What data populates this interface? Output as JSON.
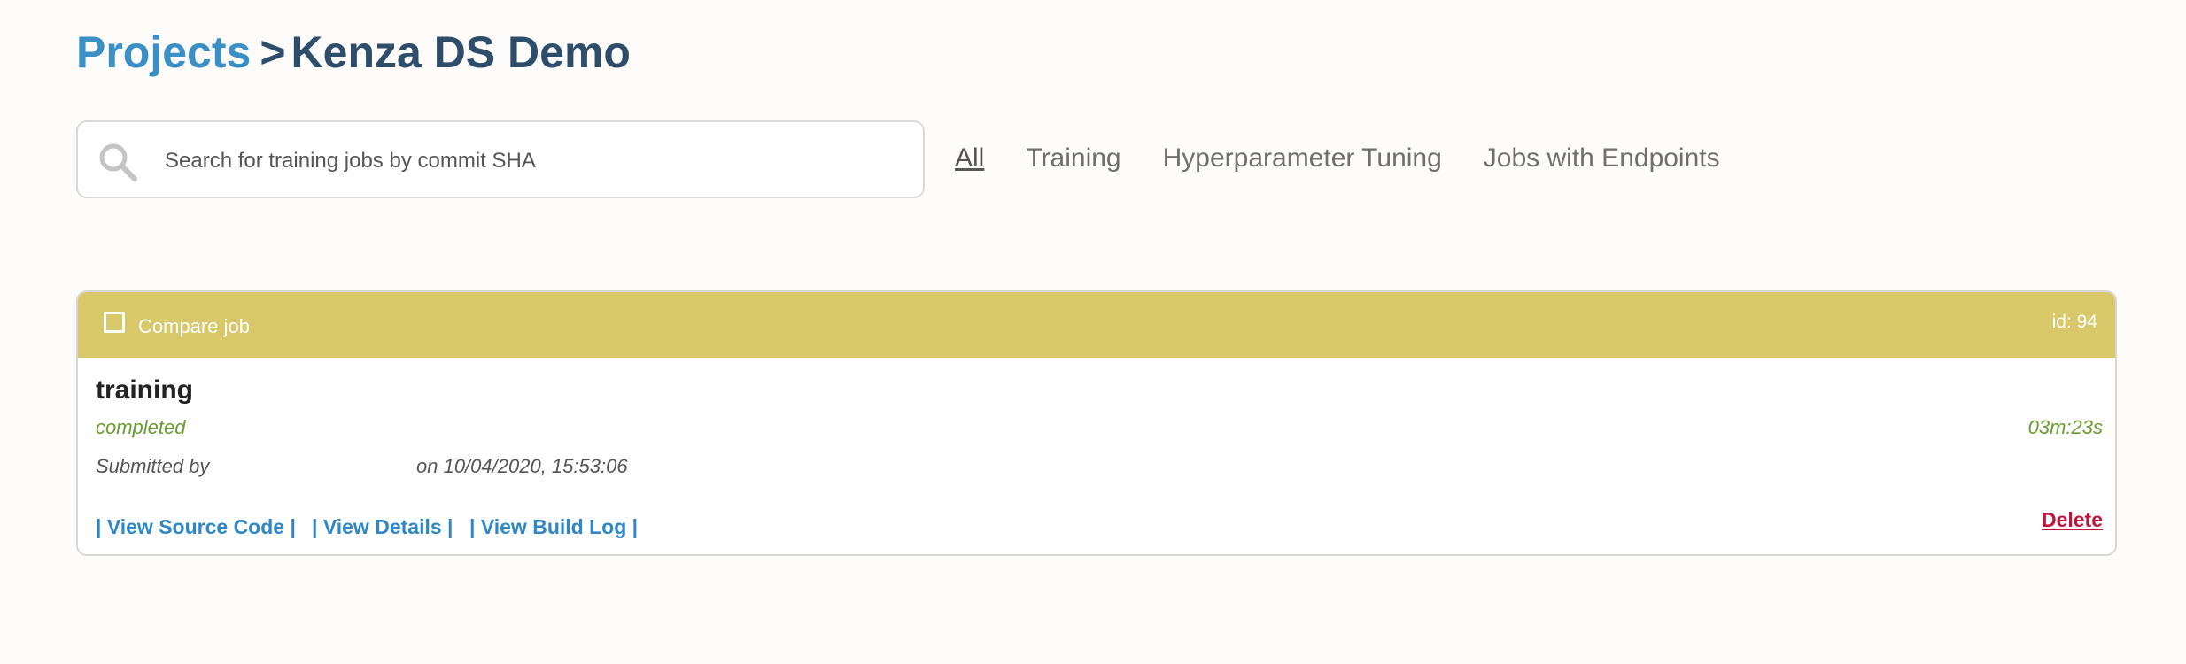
{
  "breadcrumb": {
    "parent": "Projects",
    "separator": ">",
    "current": "Kenza DS Demo"
  },
  "search": {
    "placeholder": "Search for training jobs by commit SHA",
    "value": "",
    "icon": "search-icon"
  },
  "filters": {
    "tabs": [
      {
        "label": "All",
        "active": true
      },
      {
        "label": "Training",
        "active": false
      },
      {
        "label": "Hyperparameter Tuning",
        "active": false
      },
      {
        "label": "Jobs with Endpoints",
        "active": false
      }
    ]
  },
  "job": {
    "compare_label": "Compare job",
    "id_text": "id: 94",
    "type": "training",
    "status": "completed",
    "duration": "03m:23s",
    "submitted_by_label": "Submitted by",
    "submitted_on": "on 10/04/2020, 15:53:06",
    "links": {
      "source_code": "| View Source Code |",
      "details": "| View Details |",
      "build_log": "| View Build Log |"
    },
    "delete_label": "Delete"
  },
  "colors": {
    "header_bg": "#d8c86a",
    "link": "#2f87c5",
    "status": "#6a9b2f",
    "delete": "#c0143c",
    "breadcrumb_link": "#3a8fc6",
    "breadcrumb_text": "#2e4d6a"
  }
}
